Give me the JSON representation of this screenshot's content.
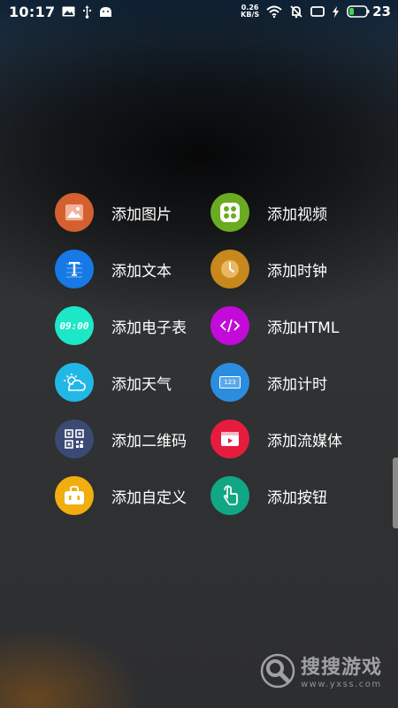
{
  "status_bar": {
    "time": "10:17",
    "net_speed_value": "0.26",
    "net_speed_unit": "KB/S",
    "battery_level": "23"
  },
  "menu": {
    "items": [
      {
        "label": "添加图片",
        "icon": "image-icon",
        "color": "#d4602f"
      },
      {
        "label": "添加视频",
        "icon": "video-icon",
        "color": "#6aab22"
      },
      {
        "label": "添加文本",
        "icon": "text-icon",
        "color": "#1679e6"
      },
      {
        "label": "添加时钟",
        "icon": "clock-icon",
        "color": "#c9881b"
      },
      {
        "label": "添加电子表",
        "icon": "digital-clock-icon",
        "color": "#1ce8c8",
        "icon_text": "09:00"
      },
      {
        "label": "添加HTML",
        "icon": "html-icon",
        "color": "#c20bd8"
      },
      {
        "label": "添加天气",
        "icon": "weather-icon",
        "color": "#22b8e6"
      },
      {
        "label": "添加计时",
        "icon": "counter-icon",
        "color": "#2b8de0",
        "icon_text": "123"
      },
      {
        "label": "添加二维码",
        "icon": "qrcode-icon",
        "color": "#3a4a74"
      },
      {
        "label": "添加流媒体",
        "icon": "stream-icon",
        "color": "#e61c3f"
      },
      {
        "label": "添加自定义",
        "icon": "custom-icon",
        "color": "#f0ae0f"
      },
      {
        "label": "添加按钮",
        "icon": "button-icon",
        "color": "#11a684"
      }
    ]
  },
  "watermark": {
    "title": "搜搜游戏",
    "url": "www.yxss.com"
  }
}
